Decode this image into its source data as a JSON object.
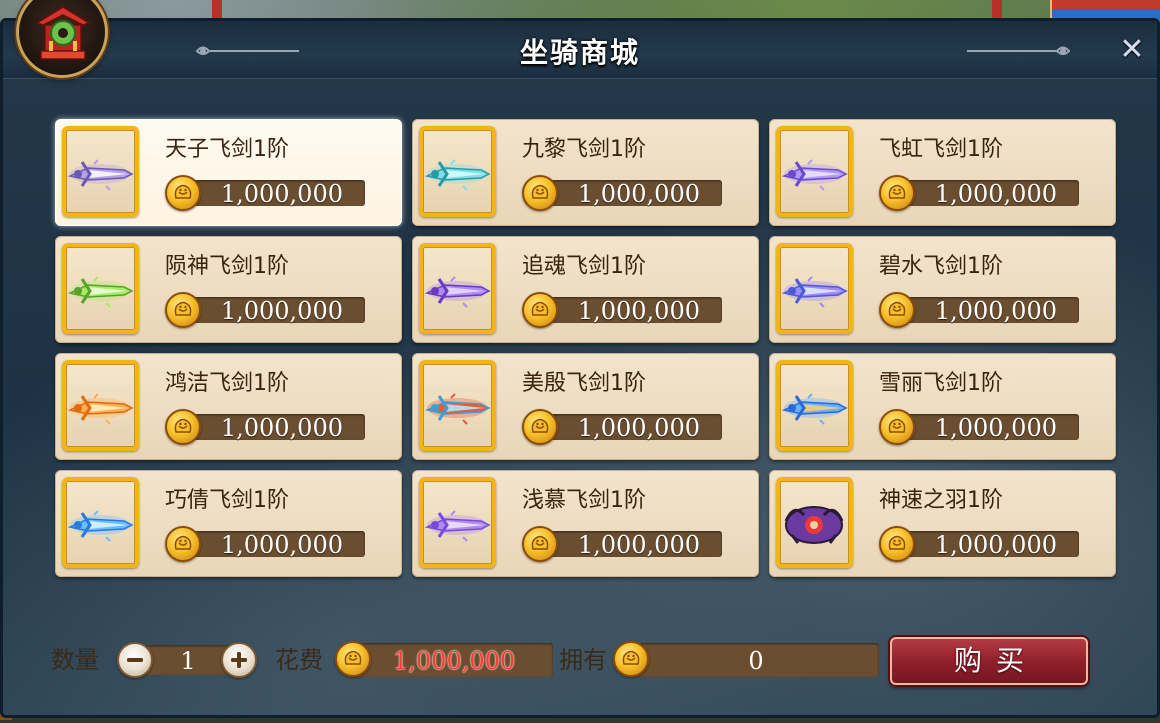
{
  "window": {
    "title": "坐骑商城",
    "close_label": "✕"
  },
  "items": [
    {
      "name": "天子飞剑1阶",
      "price": "1,000,000",
      "colors": [
        "#b8a0e8",
        "#ffffff",
        "#6a5ab0"
      ],
      "selected": true
    },
    {
      "name": "九黎飞剑1阶",
      "price": "1,000,000",
      "colors": [
        "#7fe0e6",
        "#d9ffff",
        "#2a9aa8"
      ]
    },
    {
      "name": "飞虹飞剑1阶",
      "price": "1,000,000",
      "colors": [
        "#b39af5",
        "#f0e6ff",
        "#6a4ad0"
      ]
    },
    {
      "name": "陨神飞剑1阶",
      "price": "1,000,000",
      "colors": [
        "#a6ec6a",
        "#f0ffd8",
        "#5aa02a"
      ]
    },
    {
      "name": "追魂飞剑1阶",
      "price": "1,000,000",
      "colors": [
        "#b08af0",
        "#eadcff",
        "#6a3ac0"
      ]
    },
    {
      "name": "碧水飞剑1阶",
      "price": "1,000,000",
      "colors": [
        "#a08af8",
        "#e0ecff",
        "#4a5ad8"
      ]
    },
    {
      "name": "鸿洁飞剑1阶",
      "price": "1,000,000",
      "colors": [
        "#ffb050",
        "#fff0c8",
        "#e06a10"
      ]
    },
    {
      "name": "美殷飞剑1阶",
      "price": "1,000,000",
      "colors": [
        "#e85a3a",
        "#aef0ff",
        "#3aa0d8"
      ]
    },
    {
      "name": "雪丽飞剑1阶",
      "price": "1,000,000",
      "colors": [
        "#6ab0ff",
        "#ffd070",
        "#2a6ad8"
      ]
    },
    {
      "name": "巧倩飞剑1阶",
      "price": "1,000,000",
      "colors": [
        "#6ac0ff",
        "#e0f4ff",
        "#2a78e0"
      ]
    },
    {
      "name": "浅慕飞剑1阶",
      "price": "1,000,000",
      "colors": [
        "#b08af0",
        "#f0e6ff",
        "#7a4ad8"
      ]
    },
    {
      "name": "神速之羽1阶",
      "price": "1,000,000",
      "colors": [
        "#6a3aa0",
        "#e83a3a",
        "#2a1a3a"
      ]
    }
  ],
  "footer": {
    "quantity_label": "数量",
    "quantity_value": "1",
    "cost_label": "花费",
    "cost_value": "1,000,000",
    "owned_label": "拥有",
    "owned_value": "0",
    "buy_label": "购买"
  },
  "theme": {
    "accent_gold": "#f2b418",
    "price_bar": "#6b4e30",
    "cost_red": "#ff3b30",
    "buy_red": "#8e1f2a"
  },
  "icons": {
    "emblem": "shop-pavilion-icon",
    "coin": "gold-coin-icon",
    "minus": "minus-icon",
    "plus": "plus-icon"
  }
}
